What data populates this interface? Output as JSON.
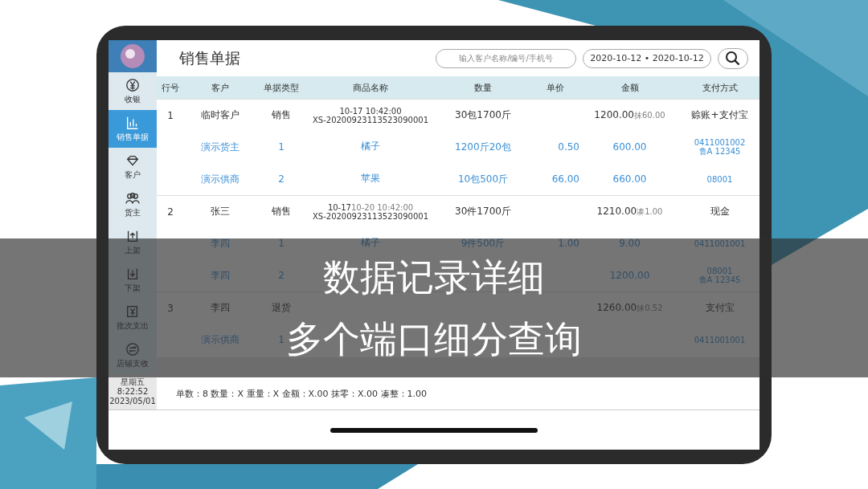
{
  "sidebar": {
    "items": [
      {
        "label": "收银",
        "selected": false
      },
      {
        "label": "销售单据",
        "selected": true
      },
      {
        "label": "客户",
        "selected": false
      },
      {
        "label": "货主",
        "selected": false
      },
      {
        "label": "上架",
        "selected": false
      },
      {
        "label": "下架",
        "selected": false
      },
      {
        "label": "批次支出",
        "selected": false
      },
      {
        "label": "店铺支收",
        "selected": false
      }
    ],
    "clock": [
      "星期五",
      "8:22:52",
      "2023/05/01"
    ]
  },
  "title": "销售单据",
  "search": {
    "placeholder": "输入客户名称/编号/手机号"
  },
  "date_range": "2020-10-12 • 2020-10-12",
  "table": {
    "columns": [
      "行号",
      "客户",
      "单据类型",
      "商品名称",
      "数量",
      "单价",
      "金额",
      "支付方式"
    ],
    "rows": [
      {
        "kind": "main",
        "index": "1",
        "customer": "临时客户",
        "type": "销售",
        "time": "10-17 10:42:00",
        "number": "XS-20200923113523090001",
        "qty": "30包1700斤",
        "amount": "1200.00",
        "amount_note": "抹60.00",
        "payment": [
          "赊账+支付宝"
        ]
      },
      {
        "kind": "detail",
        "customer": "演示货主",
        "type": "1",
        "goods": "橘子",
        "qty": "1200斤20包",
        "price": "0.50",
        "amount": "600.00",
        "payment": [
          "0411001002",
          "鲁A 12345"
        ]
      },
      {
        "kind": "detail",
        "customer": "演示供商",
        "type": "2",
        "goods": "苹果",
        "qty": "10包500斤",
        "price": "66.00",
        "amount": "660.00",
        "payment": [
          "08001"
        ]
      },
      {
        "kind": "main",
        "index": "2",
        "customer": "张三",
        "type": "销售",
        "time": "10-17",
        "time_note": "10-20 10:42:00",
        "number": "XS-20200923113523090001",
        "qty": "30件1700斤",
        "amount": "1210.00",
        "amount_note": "凑1.00",
        "payment": [
          "现金"
        ]
      },
      {
        "kind": "detail",
        "customer": "李四",
        "type": "1",
        "goods": "橘子",
        "qty": "9件500斤",
        "price": "1.00",
        "amount": "9.00",
        "payment": [
          "0411001001"
        ]
      },
      {
        "kind": "detail",
        "customer": "李四",
        "type": "2",
        "amount": "1200.00",
        "payment": [
          "08001",
          "鲁A 12345"
        ]
      },
      {
        "kind": "main",
        "index": "3",
        "customer": "李四",
        "type": "退货",
        "amount": "1260.00",
        "amount_note": "抹0.52",
        "payment": [
          "支付宝"
        ]
      },
      {
        "kind": "detail",
        "customer": "演示供商",
        "type": "1",
        "payment": [
          "0411001001"
        ]
      }
    ]
  },
  "summary": "单数：8 数量：X 重量：X 金额：X.00 抹零：X.00 凑整：1.00",
  "caption": [
    "数据记录详细",
    "多个端口细分查询"
  ]
}
